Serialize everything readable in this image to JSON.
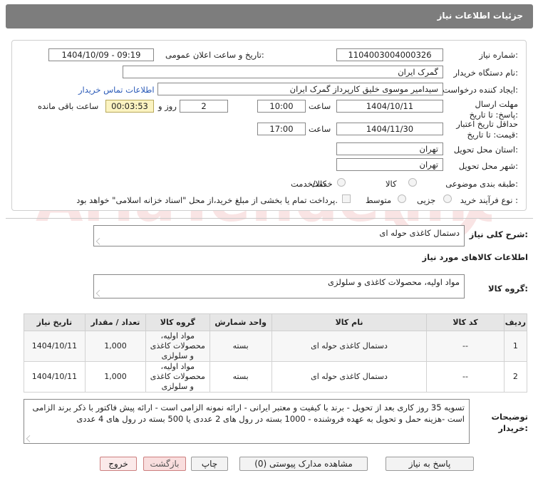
{
  "header": {
    "title": "جزئیات اطلاعات نیاز"
  },
  "form": {
    "need_number_label": "شماره نیاز:",
    "need_number": "1104003004000326",
    "announce_label": "تاریخ و ساعت اعلان عمومی:",
    "announce_value": "1404/10/09 - 09:19",
    "buyer_org_label": "نام دستگاه خریدار:",
    "buyer_org": "گمرک ایران",
    "creator_label": "ایجاد کننده درخواست:",
    "creator": "سیدامیر موسوی خلیق کارپرداز گمرک ایران",
    "contact_link": "اطلاعات تماس خریدار",
    "deadline_label": "مهلت ارسال پاسخ: تا تاریخ:",
    "deadline_date": "1404/10/11",
    "time_label": "ساعت",
    "deadline_time": "10:00",
    "days": "2",
    "days_label": "روز و",
    "remaining": "00:03:53",
    "remaining_label": "ساعت باقی مانده",
    "validity_label": "حداقل تاریخ اعتبار قیمت: تا تاریخ:",
    "validity_date": "1404/11/30",
    "validity_time": "17:00",
    "province_label": "استان محل تحویل:",
    "province": "تهران",
    "city_label": "شهر محل تحویل:",
    "city": "تهران",
    "category_label": "طبقه بندی موضوعی:",
    "category_options": [
      "کالا",
      "خدمت",
      "کالا/خدمت"
    ],
    "process_label": "نوع فرآیند خرید :",
    "process_options": [
      "جزیی",
      "متوسط"
    ],
    "payment_note": "پرداخت تمام یا بخشی از مبلغ خرید،از محل \"اسناد خزانه اسلامی\" خواهد بود."
  },
  "summary": {
    "label": "شرح کلی نیاز:",
    "value": "دستمال کاغذی حوله ای"
  },
  "goods": {
    "section_title": "اطلاعات کالاهای مورد نیاز",
    "group_label": "گروه کالا:",
    "group_value": "مواد اولیه، محصولات کاغذی و سلولزی"
  },
  "table": {
    "headers": [
      "ردیف",
      "کد کالا",
      "نام کالا",
      "واحد شمارش",
      "گروه کالا",
      "تعداد / مقدار",
      "تاریخ نیاز"
    ],
    "rows": [
      {
        "row": "1",
        "code": "--",
        "name": "دستمال کاغذی حوله ای",
        "unit": "بسته",
        "group": "مواد اولیه، محصولات کاغذی و سلولزی",
        "qty": "1,000",
        "date": "1404/10/11"
      },
      {
        "row": "2",
        "code": "--",
        "name": "دستمال کاغذی حوله ای",
        "unit": "بسته",
        "group": "مواد اولیه، محصولات کاغذی و سلولزی",
        "qty": "1,000",
        "date": "1404/10/11"
      }
    ]
  },
  "notes": {
    "label": "توضیحات خریدار:",
    "value": "تسویه 35 روز کاری بعد از تحویل - برند با کیفیت و معتبر ایرانی - ارائه نمونه الزامی است - ارائه پیش فاکتور با ذکر برند الزامی است -هزینه حمل و تحویل به عهده فروشنده - 1000 بسته در رول های 2 عددی یا 500 بسته در رول های 4 عددی"
  },
  "buttons": {
    "reply": "پاسخ به نیاز",
    "attachments": "مشاهده مدارک پیوستی (0)",
    "print": "چاپ",
    "back": "بازگشت",
    "exit": "خروج"
  },
  "watermark": "AriaTender.neT"
}
